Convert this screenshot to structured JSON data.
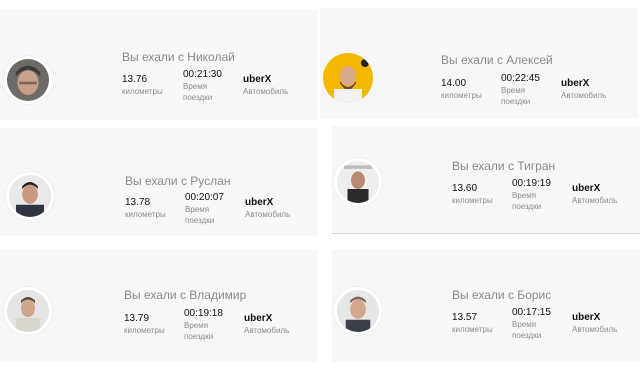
{
  "title_prefix": "Вы ехали с",
  "labels": {
    "km": "километры",
    "time": "Время поездки",
    "car": "Автомобиль"
  },
  "trips": [
    {
      "driver": "Вы ехали с Николай",
      "km": "13.76",
      "time": "00:21:30",
      "product": "uberX",
      "avatar_icon": "driver-photo-icon"
    },
    {
      "driver": "Вы ехали с Алексей",
      "km": "14.00",
      "time": "00:22:45",
      "product": "uberX",
      "avatar_icon": "driver-photo-icon"
    },
    {
      "driver": "Вы ехали с Руслан",
      "km": "13.78",
      "time": "00:20:07",
      "product": "uberX",
      "avatar_icon": "driver-photo-icon"
    },
    {
      "driver": "Вы ехали с Тигран",
      "km": "13.60",
      "time": "00:19:19",
      "product": "uberX",
      "avatar_icon": "driver-photo-icon"
    },
    {
      "driver": "Вы ехали с Владимир",
      "km": "13.79",
      "time": "00:19:18",
      "product": "uberX",
      "avatar_icon": "driver-photo-icon"
    },
    {
      "driver": "Вы ехали с Борис",
      "km": "13.57",
      "time": "00:17:15",
      "product": "uberX",
      "avatar_icon": "driver-photo-icon"
    }
  ],
  "colors": {
    "card_bg": "#f7f7f7",
    "title": "#8a8a8a",
    "label": "#8c8c8c",
    "accent_yellow": "#f5b800"
  }
}
